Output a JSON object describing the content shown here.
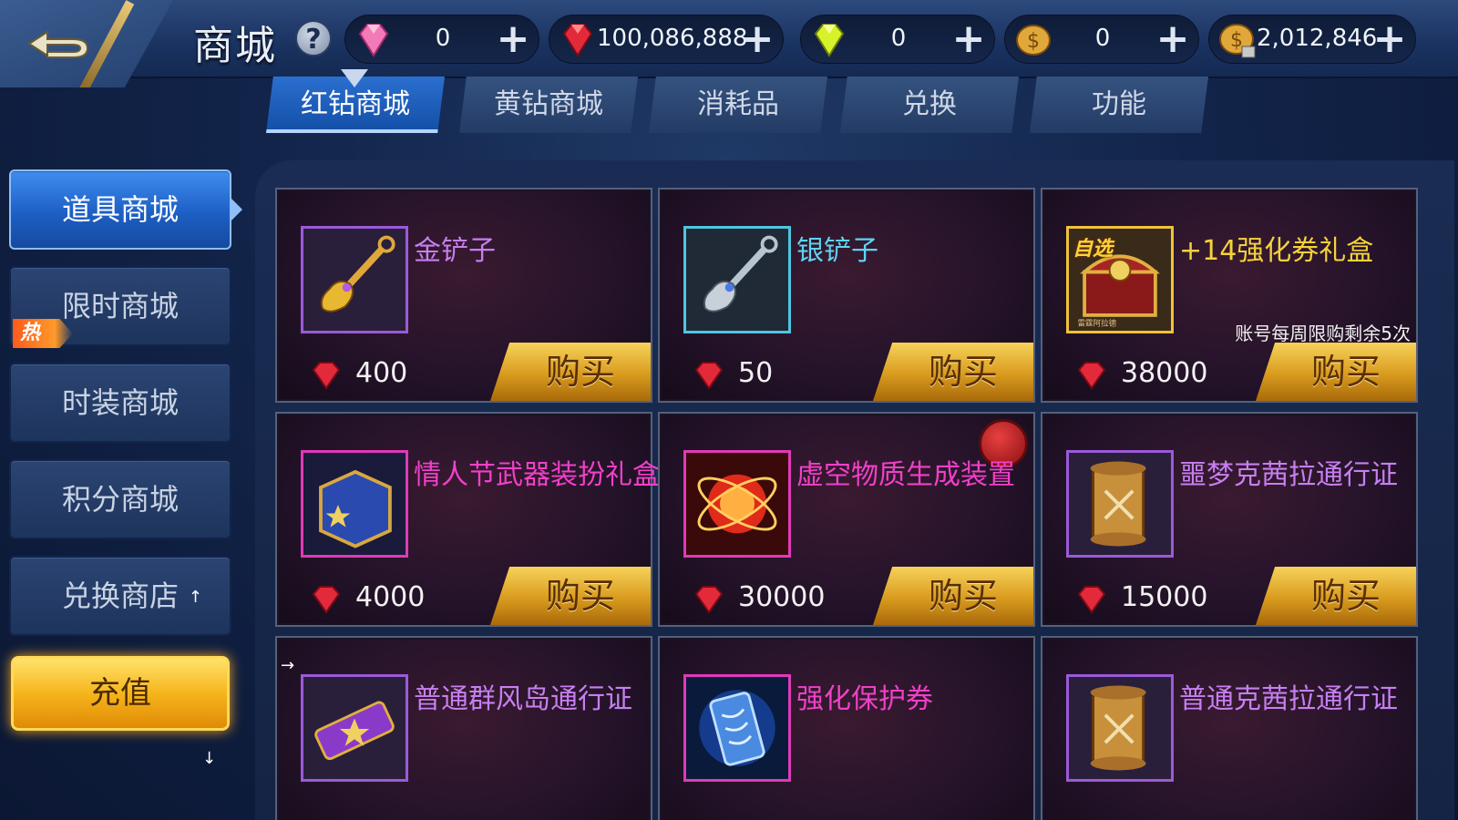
{
  "header": {
    "title": "商城",
    "help_symbol": "?",
    "currencies": [
      {
        "icon": "pink-diamond-icon",
        "value": "0",
        "plus": "+"
      },
      {
        "icon": "red-diamond-icon",
        "value": "100,086,888",
        "plus": "+"
      },
      {
        "icon": "yellow-diamond-icon",
        "value": "0",
        "plus": "+"
      },
      {
        "icon": "gold-coin-icon",
        "value": "0",
        "plus": "+"
      },
      {
        "icon": "locked-coin-icon",
        "value": "2,012,846",
        "plus": "+"
      }
    ]
  },
  "tabs": [
    {
      "label": "红钻商城",
      "active": true
    },
    {
      "label": "黄钻商城",
      "active": false
    },
    {
      "label": "消耗品",
      "active": false
    },
    {
      "label": "兑换",
      "active": false
    },
    {
      "label": "功能",
      "active": false
    }
  ],
  "sidebar": {
    "items": [
      {
        "label": "道具商城",
        "active": true
      },
      {
        "label": "限时商城",
        "badge": "热"
      },
      {
        "label": "时装商城"
      },
      {
        "label": "积分商城"
      },
      {
        "label": "兑换商店",
        "arrow": "↑"
      }
    ],
    "recharge_label": "充值",
    "scroll_down_arrow": "↓"
  },
  "items": [
    {
      "name": "金铲子",
      "price": "400",
      "buy": "购买",
      "name_color": "#c77ff0",
      "icon": "gold-shovel-icon"
    },
    {
      "name": "银铲子",
      "price": "50",
      "buy": "购买",
      "name_color": "#5fd4f0",
      "icon": "silver-shovel-icon"
    },
    {
      "name": "+14强化券礼盒",
      "price": "38000",
      "buy": "购买",
      "name_color": "#f5d23a",
      "icon": "treasure-chest-icon",
      "tag": "自选",
      "limit": "账号每周限购剩余5次"
    },
    {
      "name": "情人节武器装扮礼盒",
      "price": "4000",
      "buy": "购买",
      "name_color": "#f040c8",
      "icon": "star-moon-box-icon"
    },
    {
      "name": "虚空物质生成装置",
      "price": "30000",
      "buy": "购买",
      "name_color": "#f040c8",
      "icon": "void-device-icon"
    },
    {
      "name": "噩梦克茜拉通行证",
      "price": "15000",
      "buy": "购买",
      "name_color": "#c77ff0",
      "icon": "scroll-pass-icon"
    },
    {
      "name": "普通群风岛通行证",
      "price": "",
      "buy": "",
      "name_color": "#c77ff0",
      "icon": "ticket-icon",
      "arrow": "→"
    },
    {
      "name": "强化保护券",
      "price": "",
      "buy": "",
      "name_color": "#f040c8",
      "icon": "protection-scroll-icon"
    },
    {
      "name": "普通克茜拉通行证",
      "price": "",
      "buy": "",
      "name_color": "#c77ff0",
      "icon": "scroll-pass-icon"
    }
  ]
}
